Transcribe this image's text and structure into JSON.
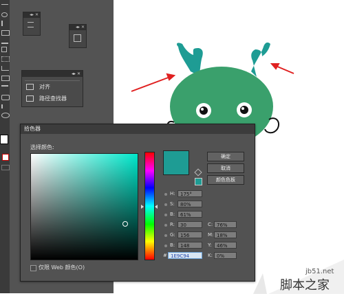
{
  "colors": {
    "workspace_bg": "#535353",
    "toolbar_bg": "#3a3a3a",
    "dialog_bg": "#525252",
    "dragon_body": "#3aa06c",
    "dragon_horns": "#1e9c94",
    "arrow_red": "#e02020",
    "current_color": "#1e9c94",
    "hex_field_bg": "#d9e6f2"
  },
  "align_panel": {
    "title_icons": "◂▸ ✕",
    "items": [
      {
        "label": "对齐",
        "icon": "align-icon"
      },
      {
        "label": "路径查找器",
        "icon": "pathfinder-icon"
      }
    ]
  },
  "mini_panels": {
    "panel1_title": "◂▸ ✕",
    "panel2_title": "◂▸ ✕"
  },
  "color_picker": {
    "title": "拾色器",
    "select_label": "选择颜色:",
    "buttons": {
      "ok": "确定",
      "cancel": "取消",
      "swatches": "颜色色板"
    },
    "hsb": {
      "h_label": "H:",
      "h_value": "175°",
      "s_label": "S:",
      "s_value": "80%",
      "b_label": "B:",
      "b_value": "61%"
    },
    "rgb": {
      "r_label": "R:",
      "r_value": "30",
      "g_label": "G:",
      "g_value": "156",
      "b_label": "B:",
      "b_value": "148"
    },
    "cmyk": {
      "c_label": "C:",
      "c_value": "76%",
      "m_label": "M:",
      "m_value": "18%",
      "y_label": "Y:",
      "y_value": "46%",
      "k_label": "K:",
      "k_value": "0%"
    },
    "hex_label": "#",
    "hex_value": "1E9C94",
    "web_only_label": "仅限 Web 颜色(O)"
  },
  "watermark": {
    "url": "jb51.net",
    "name": "脚本之家"
  }
}
